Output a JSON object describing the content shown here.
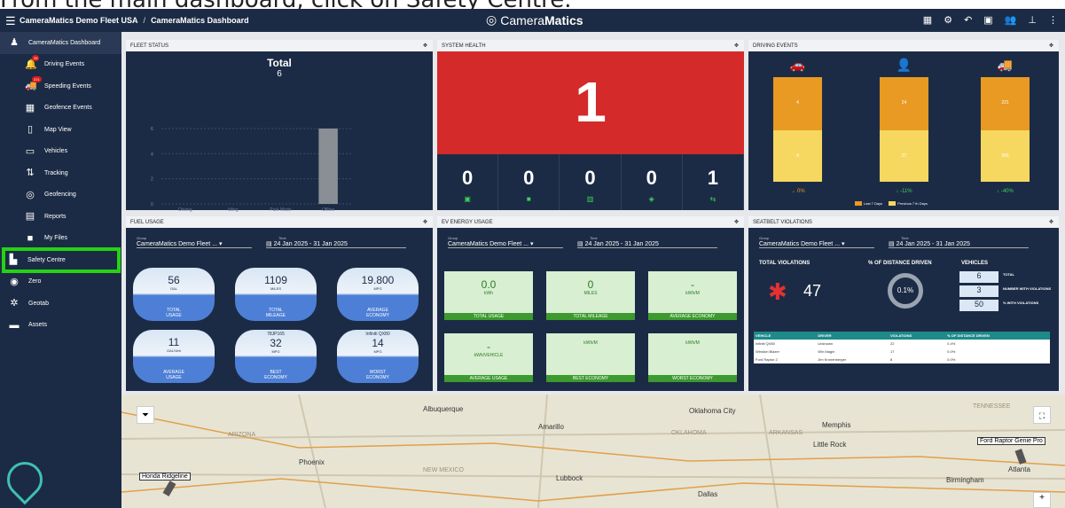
{
  "caption": "From the main dashboard, click on Safety Centre.",
  "topbar": {
    "org": "CameraMatics Demo Fleet USA",
    "sep": "/",
    "page": "CameraMatics Dashboard",
    "logo_a": "Camera",
    "logo_b": "Matics"
  },
  "sidebar": {
    "items": [
      {
        "label": "CameraMatics Dashboard",
        "icon": "dashboard-icon"
      },
      {
        "label": "Driving Events",
        "icon": "bell-icon",
        "badge": "28"
      },
      {
        "label": "Speeding Events",
        "icon": "speeding-truck-icon",
        "badge": "221"
      },
      {
        "label": "Geofence Events",
        "icon": "geofence-icon"
      },
      {
        "label": "Map View",
        "icon": "map-icon"
      },
      {
        "label": "Vehicles",
        "icon": "car-icon"
      },
      {
        "label": "Tracking",
        "icon": "tracking-icon"
      },
      {
        "label": "Geofencing",
        "icon": "target-icon"
      },
      {
        "label": "Reports",
        "icon": "report-icon"
      },
      {
        "label": "My Files",
        "icon": "folder-icon"
      },
      {
        "label": "Safety Centre",
        "icon": "safety-icon"
      },
      {
        "label": "Zero",
        "icon": "zero-icon"
      },
      {
        "label": "Geotab",
        "icon": "geotab-icon"
      },
      {
        "label": "Assets",
        "icon": "assets-icon"
      }
    ]
  },
  "fleet": {
    "title": "FLEET STATUS",
    "total_label": "Total",
    "total": "6",
    "yticks": [
      "6",
      "4",
      "2",
      "0"
    ],
    "xcats": [
      "Driving",
      "Idling",
      "Park Mode",
      "Offline"
    ],
    "legend": [
      "Driving",
      "Idling",
      "Park Mode",
      "Offline"
    ]
  },
  "chart_data": {
    "type": "bar",
    "categories": [
      "Driving",
      "Idling",
      "Park Mode",
      "Offline"
    ],
    "values": [
      0,
      0,
      0,
      6
    ],
    "ylim": [
      0,
      6
    ],
    "title": "Total"
  },
  "system": {
    "title": "SYSTEM HEALTH",
    "big": "1",
    "tiles": [
      "0",
      "0",
      "0",
      "0",
      "1"
    ]
  },
  "driving": {
    "title": "DRIVING EVENTS",
    "cols": [
      {
        "top": "4",
        "bottom": "4",
        "change": "0%"
      },
      {
        "top": "24",
        "bottom": "27",
        "change": "-11%"
      },
      {
        "top": "221",
        "bottom": "366",
        "change": "-40%"
      }
    ],
    "legend": [
      "Last 7 Days",
      "Previous 7 th Days"
    ]
  },
  "fuel": {
    "title": "FUEL USAGE",
    "group_label": "Group",
    "group": "CameraMatics Demo Fleet ...",
    "time_label": "Time",
    "time": "24 Jan 2025 - 31 Jan 2025",
    "stats": [
      {
        "v": "56",
        "u": "GAL",
        "l1": "TOTAL",
        "l2": "USAGE"
      },
      {
        "v": "1109",
        "u": "MILES",
        "l1": "TOTAL",
        "l2": "MILEAGE"
      },
      {
        "v": "19.800",
        "u": "MPG",
        "l1": "AVERAGE",
        "l2": "ECONOMY"
      },
      {
        "v": "11",
        "u": "GAL/Veh",
        "l1": "AVERAGE",
        "l2": "USAGE"
      },
      {
        "v": "32",
        "u": "MPG",
        "l1": "BEST",
        "l2": "ECONOMY",
        "n": "78JP165"
      },
      {
        "v": "14",
        "u": "MPG",
        "l1": "WORST",
        "l2": "ECONOMY",
        "n": "Infiniti QX80"
      }
    ]
  },
  "ev": {
    "title": "EV ENERGY USAGE",
    "group": "CameraMatics Demo Fleet ...",
    "time": "24 Jan 2025 - 31 Jan 2025",
    "boxes": [
      {
        "v": "0.0",
        "u": "kWh",
        "l": "TOTAL USAGE"
      },
      {
        "v": "0",
        "u": "MILES",
        "l": "TOTAL MILEAGE"
      },
      {
        "v": "-",
        "u": "kWh/M",
        "l": "AVERAGE ECONOMY"
      },
      {
        "v": "-",
        "u": "kWh/VEHICLE",
        "l": "AVERAGE USAGE"
      },
      {
        "v": "",
        "u": "kWh/M",
        "l": "BEST ECONOMY"
      },
      {
        "v": "",
        "u": "kWh/M",
        "l": "WORST ECONOMY"
      }
    ]
  },
  "seatbelt": {
    "title": "SEATBELT VIOLATIONS",
    "group": "CameraMatics Demo Fleet ...",
    "time": "24 Jan 2025 - 31 Jan 2025",
    "tv_label": "TOTAL VIOLATIONS",
    "tv": "47",
    "pct_label": "% OF DISTANCE DRIVEN",
    "pct": "0.1%",
    "veh_label": "VEHICLES",
    "veh": [
      {
        "v": "6",
        "l": "TOTAL"
      },
      {
        "v": "3",
        "l": "NUMBER WITH VIOLATIONS"
      },
      {
        "v": "50",
        "l": "% WITH VIOLATIONS"
      }
    ],
    "headers": [
      "VEHICLE",
      "DRIVER",
      "VIOLATIONS",
      "% OF DISTANCE DRIVEN"
    ],
    "rows": [
      [
        "Infiniti QX80",
        "Unknown",
        "22",
        "0.4%"
      ],
      [
        "Winston Blazer",
        "Win Magin",
        "17",
        "0.0%"
      ],
      [
        "Ford Raptor 2",
        "Jim Kronenberger",
        "8",
        "0.0%"
      ]
    ]
  },
  "map": {
    "labels": [
      "Honda Ridgeline",
      "Ford Raptor Genie Pro"
    ],
    "places": [
      "Albuquerque",
      "Phoenix",
      "Oklahoma City",
      "Dallas",
      "Memphis",
      "ARIZONA",
      "NEW MEXICO",
      "OKLAHOMA",
      "ARKANSAS",
      "TENNESSEE",
      "Amarillo",
      "Lubbock",
      "Little Rock",
      "Birmingham",
      "Atlanta"
    ]
  }
}
